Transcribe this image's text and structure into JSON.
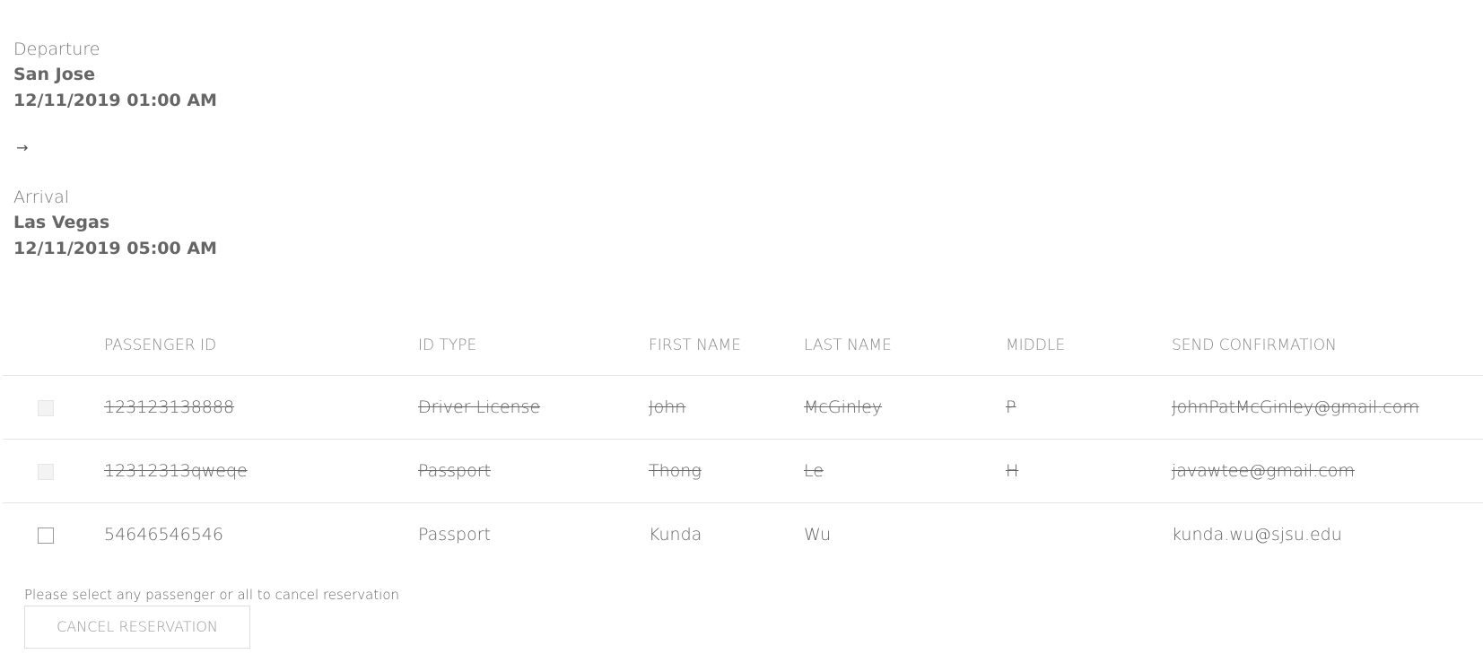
{
  "departure": {
    "label": "Departure",
    "city": "San Jose",
    "datetime": "12/11/2019 01:00 AM"
  },
  "arrow_glyph": "→",
  "arrival": {
    "label": "Arrival",
    "city": "Las Vegas",
    "datetime": "12/11/2019 05:00 AM"
  },
  "table": {
    "headers": {
      "passenger_id": "PASSENGER ID",
      "id_type": "ID TYPE",
      "first_name": "FIRST NAME",
      "last_name": "LAST NAME",
      "middle": "MIDDLE",
      "send_confirmation": "SEND CONFIRMATION"
    },
    "rows": [
      {
        "passenger_id": "123123138888",
        "id_type": "Driver License",
        "first_name": "John",
        "last_name": "McGinley",
        "middle": "P",
        "email": "JohnPatMcGinley@gmail.com",
        "cancelled": true
      },
      {
        "passenger_id": "12312313qweqe",
        "id_type": "Passport",
        "first_name": "Thong",
        "last_name": "Le",
        "middle": "H",
        "email": "javawtee@gmail.com",
        "cancelled": true
      },
      {
        "passenger_id": "54646546546",
        "id_type": "Passport",
        "first_name": "Kunda",
        "last_name": "Wu",
        "middle": "",
        "email": "kunda.wu@sjsu.edu",
        "cancelled": false
      }
    ]
  },
  "hint": "Please select any passenger or all to cancel reservation",
  "cancel_button_label": "CANCEL RESERVATION",
  "colors": {
    "text": "#666666",
    "muted": "#8a8a8a",
    "divider": "#e4e4e4"
  }
}
